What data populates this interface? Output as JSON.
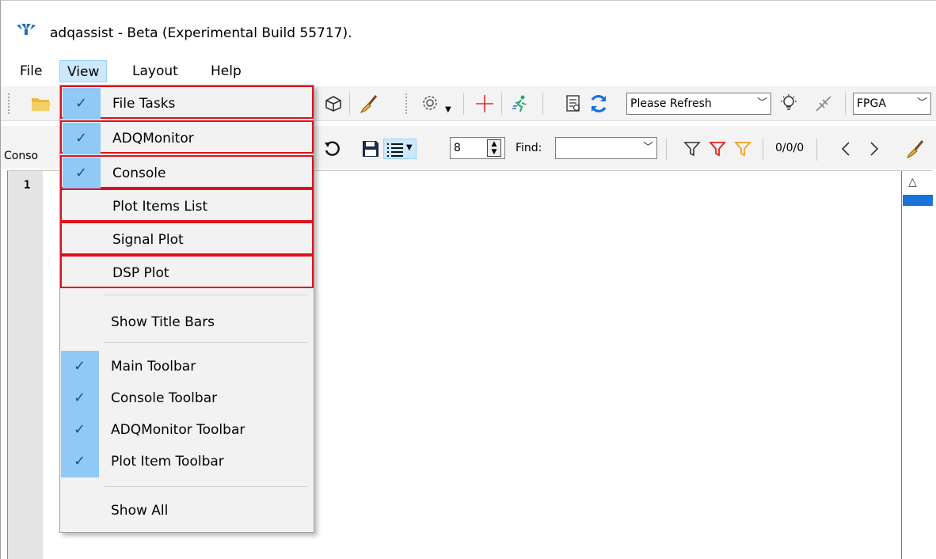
{
  "window": {
    "title": "adqassist - Beta (Experimental Build 55717)."
  },
  "menubar": {
    "items": [
      {
        "label": "File"
      },
      {
        "label": "View"
      },
      {
        "label": "Layout"
      },
      {
        "label": "Help"
      }
    ],
    "active": "View"
  },
  "toolbar_main": {
    "device_combo_value": "Please Refresh",
    "fpga_combo_value": "FPGA"
  },
  "console_panel": {
    "tab_label": "Conso",
    "lines_value": "8",
    "find_label": "Find:",
    "find_value": "",
    "match_counter": "0/0/0"
  },
  "editor": {
    "first_line_number": "1"
  },
  "view_menu": {
    "items": [
      {
        "label": "File Tasks",
        "checked": true,
        "highlighted": true
      },
      {
        "label": "ADQMonitor",
        "checked": true,
        "highlighted": true
      },
      {
        "label": "Console",
        "checked": true,
        "highlighted": true
      },
      {
        "label": "Plot Items List",
        "checked": false,
        "highlighted": true
      },
      {
        "label": "Signal Plot",
        "checked": false,
        "highlighted": true
      },
      {
        "label": "DSP Plot",
        "checked": false,
        "highlighted": true
      },
      {
        "label": "Show Title Bars",
        "checked": false,
        "highlighted": false
      },
      {
        "label": "Main Toolbar",
        "checked": true,
        "highlighted": false
      },
      {
        "label": "Console Toolbar",
        "checked": true,
        "highlighted": false
      },
      {
        "label": "ADQMonitor Toolbar",
        "checked": true,
        "highlighted": false
      },
      {
        "label": "Plot Item Toolbar",
        "checked": true,
        "highlighted": false
      },
      {
        "label": "Show All",
        "checked": false,
        "highlighted": false
      }
    ],
    "highlight_color": "#e0101a",
    "check_color": "#90c8f6"
  }
}
